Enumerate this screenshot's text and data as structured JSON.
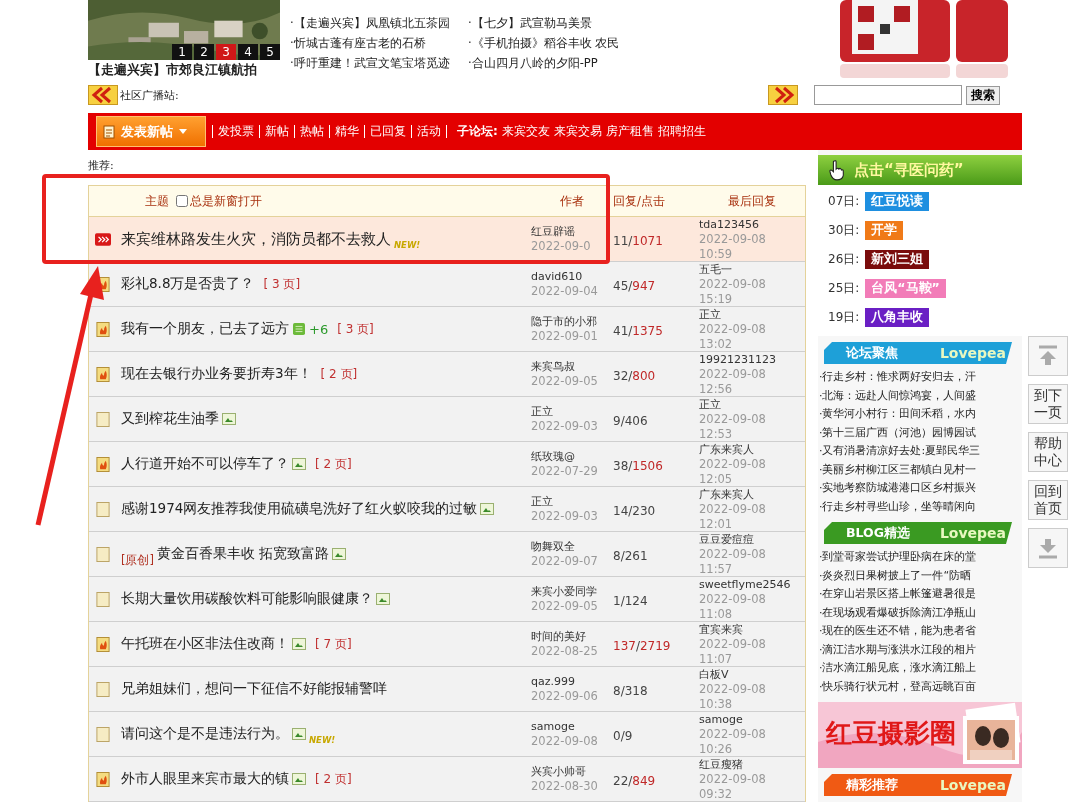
{
  "carousel": {
    "tabs": [
      {
        "label": "1",
        "selected": false
      },
      {
        "label": "2",
        "selected": false
      },
      {
        "label": "3",
        "selected": true
      },
      {
        "label": "4",
        "selected": false
      },
      {
        "label": "5",
        "selected": false
      }
    ],
    "caption": "【走遍兴宾】市郊良江镇航拍"
  },
  "news": [
    "·【走遍兴宾】凤凰镇北五茶园",
    "·【七夕】武宣勒马美景",
    "·忻城古蓬有座古老的石桥",
    "·《手机拍摄》稻谷丰收 农民",
    "·呼吁重建！武宣文笔宝塔觅迹",
    "·合山四月八岭的夕阳-PP"
  ],
  "broadcast": {
    "label": "社区广播站:"
  },
  "search": {
    "button": "搜索"
  },
  "nav": {
    "post_button": "发表新帖",
    "links": [
      "发投票",
      "新帖",
      "热帖",
      "精华",
      "已回复",
      "活动"
    ],
    "subforum_label": "子论坛:",
    "subforums": [
      "来宾交友",
      "来宾交易",
      "房产租售",
      "招聘招生"
    ]
  },
  "recommend_label": "推荐:",
  "table": {
    "topic": "主题",
    "new_window": "总是新窗打开",
    "new_window_checked": false,
    "author": "作者",
    "stats": "回复/点击",
    "last_reply": "最后回复",
    "stats_separator": "/",
    "rows": [
      {
        "kind": "hot-new",
        "title": "来宾维林路发生火灾，消防员都不去救人",
        "attachment": false,
        "badge": "NEW!",
        "author": "红豆辟谣",
        "date": "2022-09-0",
        "replies": "11",
        "views": "1071",
        "replies_hot": false,
        "views_hot": true,
        "last_user": "tda123456",
        "last_date": "2022-09-08",
        "last_time": "10:59",
        "highlighted": true
      },
      {
        "kind": "hot",
        "title": "彩礼8.8万是否贵了？",
        "attachment": false,
        "pages": "[ 3 页]",
        "author": "david610",
        "date": "2022-09-04",
        "replies": "45",
        "views": "947",
        "replies_hot": false,
        "views_hot": true,
        "last_user": "五毛一",
        "last_date": "2022-09-08",
        "last_time": "15:19",
        "highlighted": false
      },
      {
        "kind": "hot",
        "title": "我有一个朋友，已去了远方",
        "attachment": false,
        "extra": "+6",
        "pages": "[ 3 页]",
        "author": "隐于市的小邪",
        "date": "2022-09-01",
        "replies": "41",
        "views": "1375",
        "replies_hot": false,
        "views_hot": true,
        "last_user": "正立",
        "last_date": "2022-09-08",
        "last_time": "13:02",
        "highlighted": false
      },
      {
        "kind": "hot",
        "title": "现在去银行办业务要折寿3年！",
        "attachment": false,
        "pages": "[ 2 页]",
        "author": "来宾鸟叔",
        "date": "2022-09-05",
        "replies": "32",
        "views": "800",
        "replies_hot": false,
        "views_hot": true,
        "last_user": "19921231123",
        "last_date": "2022-09-08",
        "last_time": "12:56",
        "highlighted": false
      },
      {
        "kind": "normal",
        "title": "又到榨花生油季",
        "attachment": true,
        "author": "正立",
        "date": "2022-09-03",
        "replies": "9",
        "views": "406",
        "replies_hot": false,
        "views_hot": false,
        "last_user": "正立",
        "last_date": "2022-09-08",
        "last_time": "12:53",
        "highlighted": false
      },
      {
        "kind": "hot",
        "title": "人行道开始不可以停车了？",
        "attachment": true,
        "pages": "[ 2 页]",
        "author": "纸玫瑰@",
        "date": "2022-07-29",
        "replies": "38",
        "views": "1506",
        "replies_hot": false,
        "views_hot": true,
        "last_user": "广东来宾人",
        "last_date": "2022-09-08",
        "last_time": "12:05",
        "highlighted": false
      },
      {
        "kind": "normal",
        "title": "感谢1974网友推荐我使用硫磺皂洗好了红火蚁咬我的过敏",
        "attachment": true,
        "author": "正立",
        "date": "2022-09-03",
        "replies": "14",
        "views": "230",
        "replies_hot": false,
        "views_hot": false,
        "last_user": "广东来宾人",
        "last_date": "2022-09-08",
        "last_time": "12:01",
        "highlighted": false
      },
      {
        "kind": "normal",
        "prefix": "[原创]",
        "title": "黄金百香果丰收 拓宽致富路",
        "attachment": true,
        "author": "吻舞双全",
        "date": "2022-09-07",
        "replies": "8",
        "views": "261",
        "replies_hot": false,
        "views_hot": false,
        "last_user": "豆豆爱痘痘",
        "last_date": "2022-09-08",
        "last_time": "11:57",
        "highlighted": false
      },
      {
        "kind": "normal",
        "title": "长期大量饮用碳酸饮料可能影响眼健康？",
        "attachment": true,
        "author": "来宾小爱同学",
        "date": "2022-09-05",
        "replies": "1",
        "views": "124",
        "replies_hot": false,
        "views_hot": false,
        "last_user": "sweetflyme2546",
        "last_date": "2022-09-08",
        "last_time": "11:08",
        "highlighted": false
      },
      {
        "kind": "hot",
        "title": "午托班在小区非法住改商！",
        "attachment": true,
        "pages": "[ 7 页]",
        "author": "时间的美好",
        "date": "2022-08-25",
        "replies": "137",
        "views": "2719",
        "replies_hot": true,
        "views_hot": true,
        "last_user": "宜宾来宾",
        "last_date": "2022-09-08",
        "last_time": "11:07",
        "highlighted": false
      },
      {
        "kind": "normal",
        "title": "兄弟姐妹们，想问一下征信不好能报辅警咩",
        "attachment": false,
        "author": "qaz.999",
        "date": "2022-09-06",
        "replies": "8",
        "views": "318",
        "replies_hot": false,
        "views_hot": false,
        "last_user": "白板V",
        "last_date": "2022-09-08",
        "last_time": "10:38",
        "highlighted": false
      },
      {
        "kind": "normal",
        "title": "请问这个是不是违法行为。",
        "attachment": true,
        "badge": "NEW!",
        "author": "samoge",
        "date": "2022-09-08",
        "replies": "0",
        "views": "9",
        "replies_hot": false,
        "views_hot": false,
        "last_user": "samoge",
        "last_date": "2022-09-08",
        "last_time": "10:26",
        "highlighted": false
      },
      {
        "kind": "hot",
        "title": "外市人眼里来宾市最大的镇",
        "attachment": true,
        "pages": "[ 2 页]",
        "author": "兴宾小帅哥",
        "date": "2022-08-30",
        "replies": "22",
        "views": "849",
        "replies_hot": false,
        "views_hot": true,
        "last_user": "红豆瘦猪",
        "last_date": "2022-09-08",
        "last_time": "09:32",
        "highlighted": false
      }
    ]
  },
  "sidebar": {
    "banner": "点击“寻医问药”",
    "events": [
      {
        "day": "07日:",
        "tag": "红豆悦读",
        "color": "#1e8fe0"
      },
      {
        "day": "30日:",
        "tag": "开学",
        "color": "#f07a18"
      },
      {
        "day": "26日:",
        "tag": "新刘三姐",
        "color": "#7a0c0c"
      },
      {
        "day": "25日:",
        "tag": "台风“马鞍”",
        "color": "#f27cb8"
      },
      {
        "day": "19日:",
        "tag": "八角丰收",
        "color": "#6a1fc4"
      }
    ],
    "sections": [
      {
        "title": "论坛聚焦",
        "brand": "Lovepea",
        "color": "#1ea0d8",
        "items": [
          "·行走乡村：惟求两好安归去，汗",
          "·北海：远赴人间惊鸿宴，人间盛",
          "·黄华河小村行：田间禾稻，水内",
          "·第十三届广西（河池）园博园试",
          "·又有消暑清凉好去处:夏郢民华三",
          "·美丽乡村柳江区三都镇白见村一",
          "·实地考察防城港港口区乡村振兴",
          "·行走乡村寻些山珍，坐等晴闲向"
        ]
      },
      {
        "title": "BLOG精选",
        "brand": "Lovepea",
        "color": "#3a9a22",
        "items": [
          "·到堂哥家尝试护理卧病在床的堂",
          "·炎炎烈日果树披上了一件“防晒",
          "·在穿山岩景区搭上帐篷避暑很是",
          "·在现场观看爆破拆除滴江净瓶山",
          "·现在的医生还不错，能为患者省",
          "·滴江洁水期与涨洪水江段的相片",
          "·洁水滴江船见底，涨水滴江船上",
          "·快乐骑行状元村，登高远眺百亩"
        ]
      }
    ],
    "photo_banner": "红豆摄影圈",
    "bottom_section": {
      "title": "精彩推荐",
      "brand": "Lovepea",
      "color": "#f05a14"
    }
  },
  "float_buttons": [
    {
      "kind": "up"
    },
    {
      "kind": "text",
      "label": "到下一页"
    },
    {
      "kind": "text",
      "label": "帮助中心"
    },
    {
      "kind": "text",
      "label": "回到首页"
    },
    {
      "kind": "down"
    }
  ]
}
